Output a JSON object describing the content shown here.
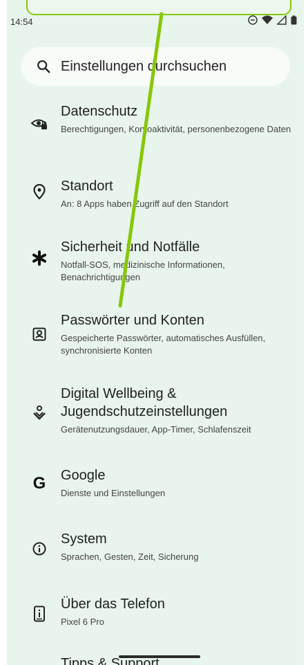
{
  "status_bar": {
    "time": "14:54"
  },
  "search": {
    "placeholder": "Einstellungen durchsuchen"
  },
  "items": [
    {
      "title": "Datenschutz",
      "subtitle": "Berechtigungen, Kontoaktivität, personenbezogene Daten",
      "icon": "privacy-eye-lock-icon"
    },
    {
      "title": "Standort",
      "subtitle": "An: 8 Apps haben Zugriff auf den Standort",
      "icon": "location-pin-icon"
    },
    {
      "title": "Sicherheit und Notfälle",
      "subtitle": "Notfall-SOS, medizinische Informationen, Benachrichtigungen",
      "icon": "asterisk-icon"
    },
    {
      "title": "Passwörter und Konten",
      "subtitle": "Gespeicherte Passwörter, automatisches Ausfüllen, synchronisierte Konten",
      "icon": "account-box-icon"
    },
    {
      "title": "Digital Wellbeing & Jugendschutzeinstellungen",
      "subtitle": "Gerätenutzungsdauer, App-Timer, Schlafenszeit",
      "icon": "wellbeing-icon"
    },
    {
      "title": "Google",
      "subtitle": "Dienste und Einstellungen",
      "icon": "google-icon"
    },
    {
      "title": "System",
      "subtitle": "Sprachen, Gesten, Zeit, Sicherung",
      "icon": "info-icon"
    },
    {
      "title": "Über das Telefon",
      "subtitle": "Pixel 6 Pro",
      "icon": "phone-info-icon"
    }
  ],
  "partial_item": {
    "title": "Tipps & Support"
  },
  "colors": {
    "background": "#e8f5ec",
    "accent_overlay": "#86c80a"
  }
}
